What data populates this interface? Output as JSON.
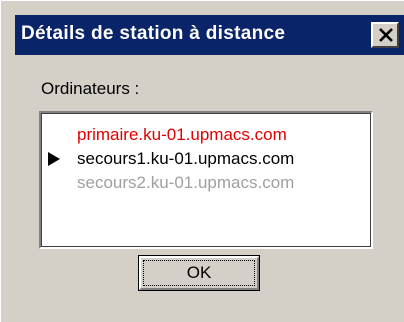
{
  "window": {
    "title": "Détails de station à distance"
  },
  "computers_label": "Ordinateurs :",
  "computers": [
    {
      "name": "primaire.ku-01.upmacs.com",
      "color": "#e00000",
      "current": false
    },
    {
      "name": "secours1.ku-01.upmacs.com",
      "color": "#000000",
      "current": true
    },
    {
      "name": "secours2.ku-01.upmacs.com",
      "color": "#a0a0a0",
      "current": false
    }
  ],
  "ok_label": "OK",
  "colors": {
    "titlebar": "#0a246a",
    "face": "#d4d0c8"
  }
}
